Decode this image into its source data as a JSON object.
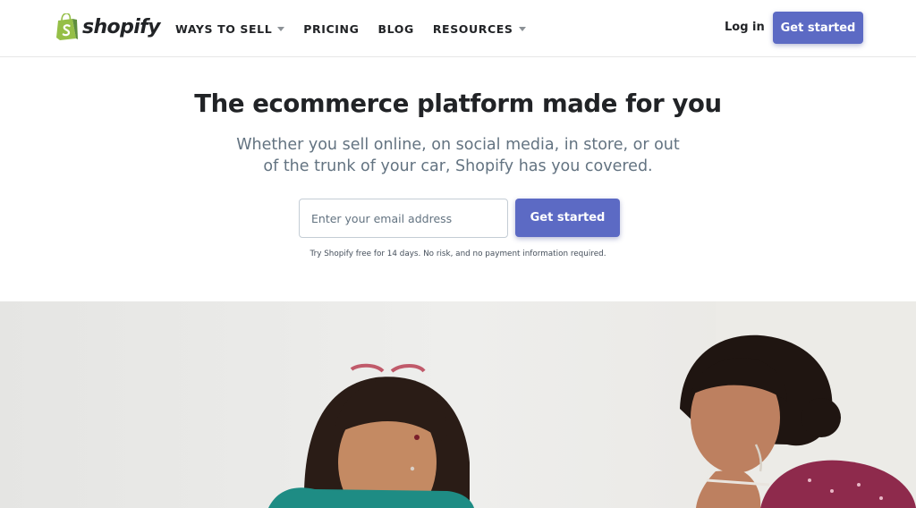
{
  "brand": {
    "name": "shopify",
    "logo_color": "#95bf47"
  },
  "nav": {
    "items": [
      {
        "label": "WAYS TO SELL",
        "has_dropdown": true
      },
      {
        "label": "PRICING",
        "has_dropdown": false
      },
      {
        "label": "BLOG",
        "has_dropdown": false
      },
      {
        "label": "RESOURCES",
        "has_dropdown": true
      }
    ],
    "login_label": "Log in",
    "cta_label": "Get started"
  },
  "hero": {
    "title": "The ecommerce platform made for you",
    "subtitle": "Whether you sell online, on social media, in store, or out of the trunk of your car, Shopify has you covered.",
    "email_placeholder": "Enter your email address",
    "email_value": "",
    "cta_label": "Get started",
    "note": "Try Shopify free for 14 days. No risk, and no payment information required."
  },
  "colors": {
    "accent": "#5c6ac4",
    "text": "#212326",
    "subtext": "#637381"
  }
}
